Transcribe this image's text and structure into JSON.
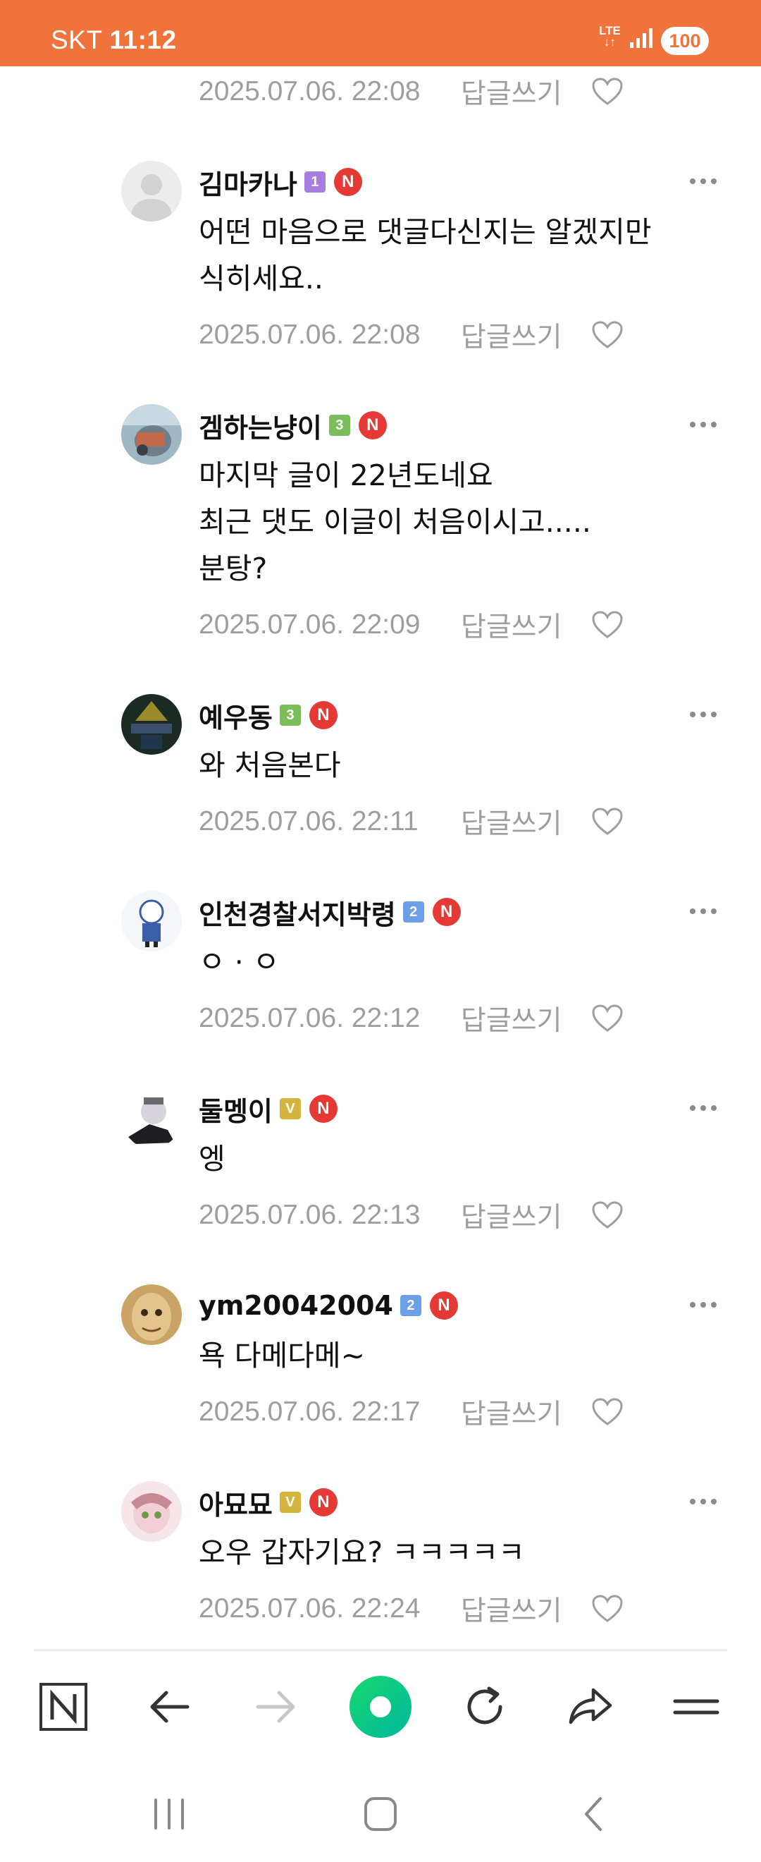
{
  "status_bar": {
    "carrier": "SKT",
    "time": "11:12",
    "network": "LTE",
    "battery": "100",
    "background_color": "#ef733a"
  },
  "comments": [
    {
      "author": "",
      "level": "",
      "body": "",
      "timestamp": "2025.07.06. 22:08",
      "reply_label": "답글쓰기"
    },
    {
      "author": "김마카나",
      "level": "1",
      "level_color": "#a67ee0",
      "badge": "N",
      "avatar": "default-avatar",
      "body": "어떤 마음으로 댓글다신지는 알겠지만\n식히세요..",
      "timestamp": "2025.07.06. 22:08",
      "reply_label": "답글쓰기"
    },
    {
      "author": "겜하는냥이",
      "level": "3",
      "level_color": "#7cbd5b",
      "badge": "N",
      "avatar": "cat-photo-avatar",
      "body": "마지막 글이 22년도네요\n최근 댓도 이글이 처음이시고.....\n분탕?",
      "timestamp": "2025.07.06. 22:09",
      "reply_label": "답글쓰기"
    },
    {
      "author": "예우동",
      "level": "3",
      "level_color": "#7cbd5b",
      "badge": "N",
      "avatar": "dark-scene-avatar",
      "body": "와 처음본다",
      "timestamp": "2025.07.06. 22:11",
      "reply_label": "답글쓰기"
    },
    {
      "author": "인천경찰서지박령",
      "level": "2",
      "level_color": "#6d9ee8",
      "badge": "N",
      "avatar": "blue-character-avatar",
      "body": "ㅇ · ㅇ",
      "timestamp": "2025.07.06. 22:12",
      "reply_label": "답글쓰기"
    },
    {
      "author": "둘멩이",
      "level": "V",
      "level_color": "#d4b43c",
      "badge": "N",
      "avatar": "anime-girl-avatar",
      "body": "엥",
      "timestamp": "2025.07.06. 22:13",
      "reply_label": "답글쓰기"
    },
    {
      "author": "ym20042004",
      "level": "2",
      "level_color": "#6d9ee8",
      "badge": "N",
      "avatar": "face-avatar",
      "body": "욕 다메다메~",
      "timestamp": "2025.07.06. 22:17",
      "reply_label": "답글쓰기"
    },
    {
      "author": "아묘묘",
      "level": "V",
      "level_color": "#d4b43c",
      "badge": "N",
      "avatar": "pink-character-avatar",
      "body": "오우 갑자기요? ㅋㅋㅋㅋㅋ",
      "timestamp": "2025.07.06. 22:24",
      "reply_label": "답글쓰기"
    }
  ],
  "toolbar": {
    "icons": [
      "naver-home-icon",
      "back-arrow-icon",
      "forward-arrow-icon",
      "green-dot-icon",
      "refresh-icon",
      "share-icon",
      "menu-icon"
    ],
    "accent_color": "#03c75a"
  },
  "system_nav": {
    "icons": [
      "recent-apps-icon",
      "home-icon",
      "back-icon"
    ]
  }
}
